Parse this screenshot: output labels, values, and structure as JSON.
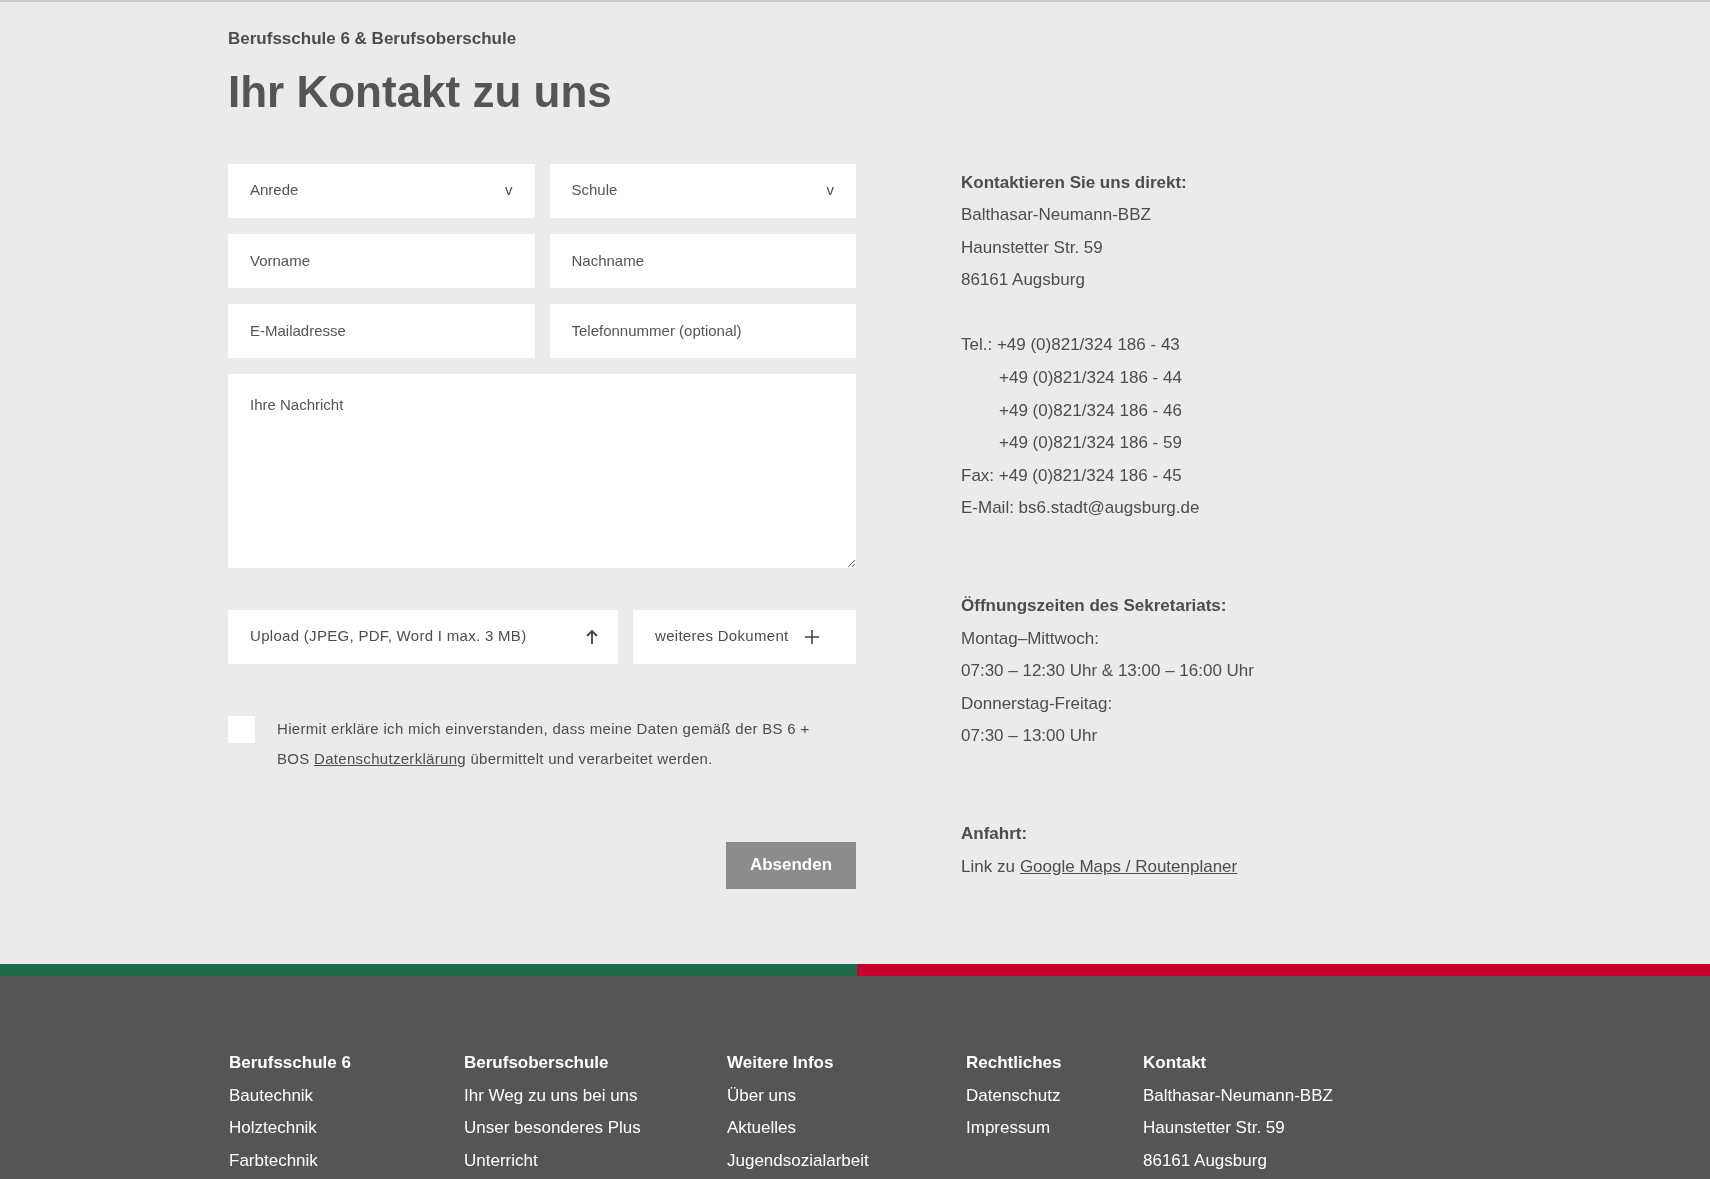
{
  "header": {
    "subtitle": "Berufsschule 6 & Berufsoberschule",
    "title": "Ihr Kontakt zu uns"
  },
  "form": {
    "fields": [
      {
        "kind": "select",
        "placeholder": "Anrede",
        "caret": "v"
      },
      {
        "kind": "select",
        "placeholder": "Schule",
        "caret": "v"
      },
      {
        "kind": "input",
        "placeholder": "Vorname"
      },
      {
        "kind": "input",
        "placeholder": "Nachname"
      },
      {
        "kind": "input",
        "placeholder": "E-Mailadresse"
      },
      {
        "kind": "input",
        "placeholder": "Telefonnummer (optional)"
      },
      {
        "kind": "textarea",
        "placeholder": "Ihre Nachricht"
      }
    ],
    "uploads": [
      {
        "kind": "upload",
        "label": "Upload (JPEG, PDF, Word I max. 3 MB)"
      },
      {
        "kind": "add",
        "label": "weiteres Dokument"
      }
    ],
    "consent": {
      "checked": false,
      "before": "Hiermit erkläre ich mich einverstanden, dass meine Daten gemäß der BS 6 + BOS",
      "link": "Datenschutzerklärung",
      "after": "übermittelt und verarbeitet werden."
    },
    "submit": "Absenden"
  },
  "contact": [
    {
      "heading": "Kontaktieren Sie uns direkt:",
      "groups": [
        [
          {
            "kind": "text",
            "text": "Balthasar-Neumann-BBZ"
          },
          {
            "kind": "text",
            "text": "Haunstetter Str. 59"
          },
          {
            "kind": "text",
            "text": "86161 Augsburg"
          }
        ],
        [
          {
            "kind": "text",
            "text": "Tel.: +49 (0)821/324 186 - 43"
          },
          {
            "kind": "indented",
            "text": "+49 (0)821/324 186 - 44"
          },
          {
            "kind": "indented",
            "text": "+49 (0)821/324 186 - 46"
          },
          {
            "kind": "indented",
            "text": "+49 (0)821/324 186 - 59"
          },
          {
            "kind": "text",
            "text": "Fax: +49 (0)821/324 186 - 45"
          },
          {
            "kind": "text",
            "text": "E-Mail: bs6.stadt@augsburg.de"
          }
        ]
      ]
    },
    {
      "heading": "Öffnungszeiten des Sekretariats:",
      "groups": [
        [
          {
            "kind": "text",
            "text": "Montag–Mittwoch:"
          },
          {
            "kind": "text",
            "text": "07:30 – 12:30 Uhr & 13:00 – 16:00 Uhr"
          },
          {
            "kind": "text",
            "text": "Donnerstag-Freitag:"
          },
          {
            "kind": "text",
            "text": "07:30 – 13:00 Uhr"
          }
        ]
      ]
    },
    {
      "heading": "Anfahrt:",
      "groups": [
        [
          {
            "kind": "link",
            "text": "Link zu",
            "link": "Google Maps / Routenplaner"
          }
        ]
      ]
    }
  ],
  "footer": {
    "columns": [
      {
        "heading": "Berufsschule 6",
        "links": [
          "Bautechnik",
          "Holztechnik",
          "Farbtechnik"
        ]
      },
      {
        "heading": "Berufsoberschule",
        "links": [
          "Ihr Weg zu uns bei uns",
          "Unser besonderes Plus",
          "Unterricht"
        ]
      },
      {
        "heading": "Weitere Infos",
        "links": [
          "Über uns",
          "Aktuelles",
          "Jugendsozialarbeit"
        ]
      },
      {
        "heading": "Rechtliches",
        "links": [
          "Datenschutz",
          "Impressum"
        ]
      },
      {
        "heading": "Kontakt",
        "links": [
          "Balthasar-Neumann-BBZ",
          "Haunstetter Str. 59",
          "86161 Augsburg"
        ]
      }
    ]
  }
}
